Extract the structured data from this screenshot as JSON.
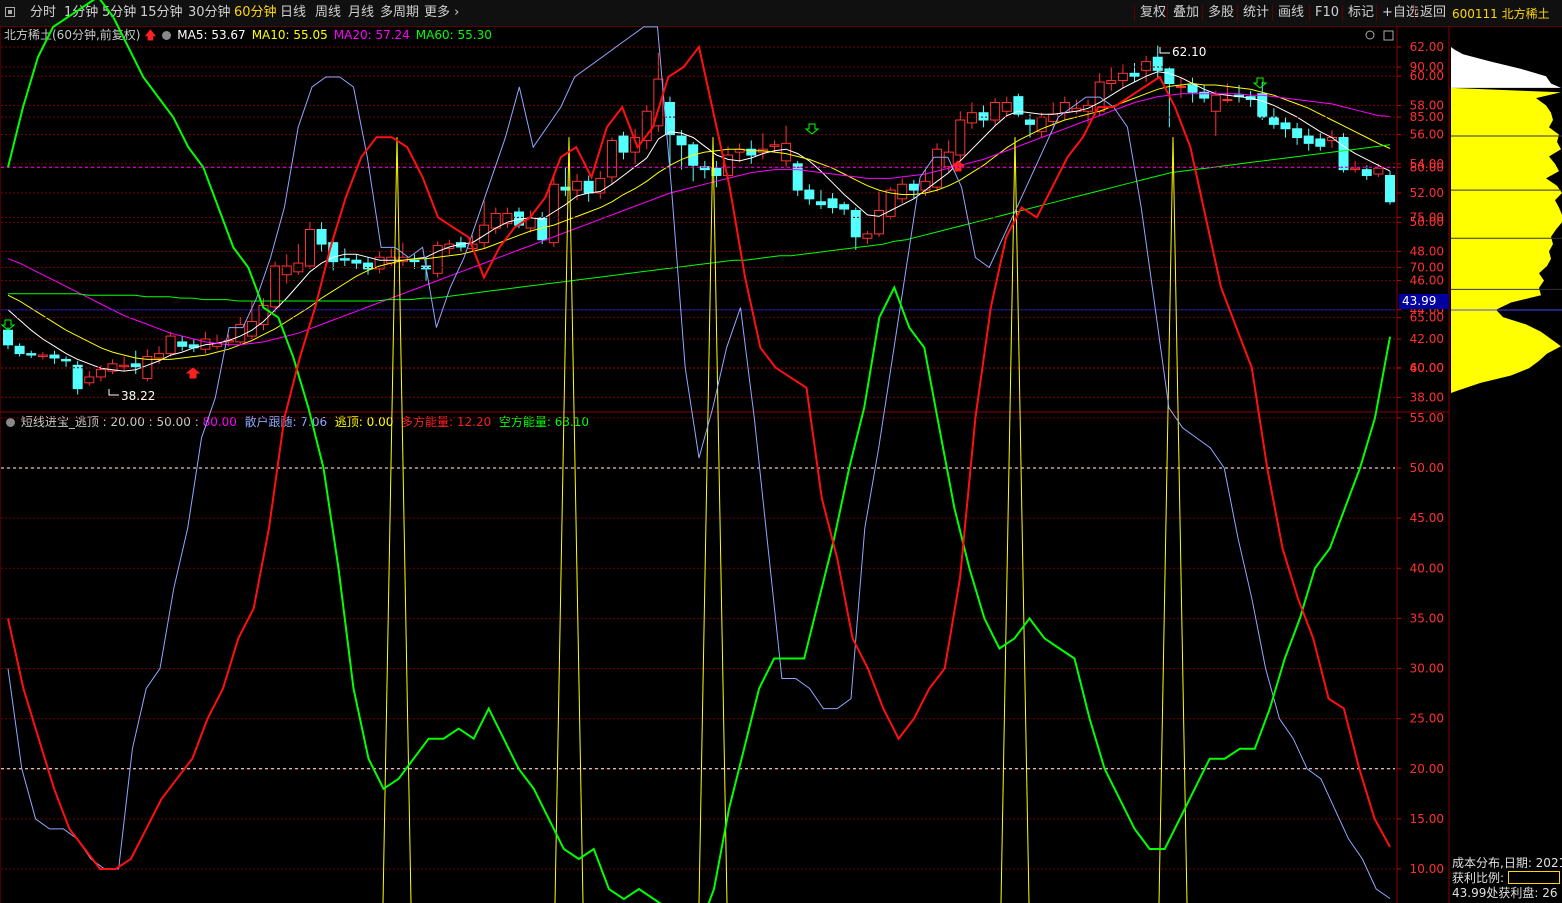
{
  "toolbar": {
    "periods": [
      "分时",
      "1分钟",
      "5分钟",
      "15分钟",
      "30分钟",
      "60分钟",
      "日线",
      "周线",
      "月线",
      "多周期",
      "更多 ›"
    ],
    "active_period": "60分钟",
    "right_buttons": [
      "复权",
      "叠加",
      "多股",
      "统计",
      "画线",
      "F10",
      "标记",
      "+自选",
      "返回"
    ]
  },
  "stock": {
    "code_name": "600111 北方稀土"
  },
  "main_chart": {
    "title": "北方稀土(60分钟,前复权)",
    "ma_labels": [
      {
        "text": "MA5: 53.67",
        "color": "#ffffff"
      },
      {
        "text": "MA10: 55.05",
        "color": "#ffff00"
      },
      {
        "text": "MA20: 57.24",
        "color": "#ff00ff"
      },
      {
        "text": "MA60: 55.30",
        "color": "#00ff00"
      }
    ],
    "price_axis": [
      "62.00",
      "60.00",
      "58.00",
      "56.00",
      "54.00",
      "52.00",
      "50.00",
      "48.00",
      "46.00",
      "44.00",
      "42.00",
      "40.00",
      "38.00"
    ],
    "current_price": "43.99",
    "high_label": "62.10",
    "low_label": "38.22"
  },
  "indicator": {
    "title_parts": [
      {
        "text": "短线进宝_逃顶 : 20.00 : 50.00 : ",
        "color": "#c8c8c8"
      },
      {
        "text": "80.00",
        "color": "#ff00ff"
      },
      {
        "text": "  散户跟随: 7.06",
        "color": "#8ea8ff"
      },
      {
        "text": "  逃顶: 0.00",
        "color": "#ffff00"
      },
      {
        "text": "  多方能量: ",
        "color": "#ff2020"
      },
      {
        "text": "12.20",
        "color": "#ff2020"
      },
      {
        "text": "  空方能量: 63.10",
        "color": "#00ff00"
      }
    ],
    "axis": [
      "90.00",
      "85.00",
      "80.00",
      "75.00",
      "70.00",
      "65.00",
      "60.00",
      "55.00",
      "50.00",
      "45.00",
      "40.00",
      "35.00",
      "30.00",
      "25.00",
      "20.00",
      "15.00",
      "10.00"
    ]
  },
  "side_panel": {
    "cost_dist": "成本分布,日期: 2021",
    "profit_ratio": "获利比例:",
    "profit_line": "43.99处获利盘: 26"
  },
  "colors": {
    "up": "#ff3232",
    "down": "#54ffff",
    "ma5": "#ffffff",
    "ma10": "#ffff00",
    "ma20": "#ff00ff",
    "ma60": "#00ff00"
  },
  "chart_data": {
    "type": "candlestick",
    "candles": [
      [
        42.6,
        41.6,
        42.8,
        41.3
      ],
      [
        41.5,
        41.0,
        41.7,
        40.8
      ],
      [
        41.0,
        40.9,
        41.2,
        40.7
      ],
      [
        40.8,
        40.9,
        41.1,
        40.6
      ],
      [
        40.9,
        40.7,
        41.2,
        40.3
      ],
      [
        40.6,
        40.5,
        40.8,
        40.1
      ],
      [
        40.2,
        38.6,
        40.5,
        38.2
      ],
      [
        39.0,
        39.4,
        39.8,
        38.8
      ],
      [
        39.4,
        39.9,
        40.2,
        39.1
      ],
      [
        39.8,
        40.3,
        40.6,
        39.6
      ],
      [
        40.1,
        40.2,
        40.8,
        39.8
      ],
      [
        40.3,
        40.1,
        41.2,
        39.6
      ],
      [
        39.3,
        40.8,
        41.3,
        39.1
      ],
      [
        40.7,
        41.0,
        41.5,
        40.3
      ],
      [
        41.0,
        42.2,
        42.5,
        40.8
      ],
      [
        41.8,
        41.5,
        42.2,
        41.2
      ],
      [
        41.6,
        41.4,
        42.0,
        41.1
      ],
      [
        41.3,
        42.0,
        42.5,
        41.0
      ],
      [
        41.5,
        41.7,
        42.3,
        41.3
      ],
      [
        41.8,
        41.9,
        42.3,
        41.5
      ],
      [
        41.8,
        43.0,
        43.5,
        41.6
      ],
      [
        42.2,
        43.2,
        44.6,
        42.0
      ],
      [
        43.0,
        44.3,
        44.8,
        42.6
      ],
      [
        44.2,
        47.0,
        47.3,
        43.8
      ],
      [
        46.4,
        47.0,
        47.8,
        45.8
      ],
      [
        46.6,
        47.2,
        48.5,
        46.4
      ],
      [
        47.0,
        49.5,
        50.0,
        46.8
      ],
      [
        49.5,
        48.5,
        50.0,
        48.0
      ],
      [
        48.6,
        47.3,
        48.7,
        46.7
      ],
      [
        47.5,
        47.4,
        48.2,
        47.0
      ],
      [
        47.4,
        47.2,
        47.8,
        46.8
      ],
      [
        47.2,
        46.8,
        47.6,
        46.4
      ],
      [
        46.8,
        47.6,
        48.0,
        46.5
      ],
      [
        47.2,
        47.6,
        48.2,
        47.0
      ],
      [
        47.3,
        47.6,
        48.6,
        47.0
      ],
      [
        47.4,
        47.3,
        47.8,
        46.8
      ],
      [
        47.0,
        46.8,
        47.6,
        46.0
      ],
      [
        46.5,
        48.4,
        48.7,
        46.2
      ],
      [
        48.2,
        48.5,
        48.8,
        47.8
      ],
      [
        48.6,
        48.3,
        49.0,
        48.0
      ],
      [
        48.2,
        48.5,
        49.1,
        48.0
      ],
      [
        48.6,
        49.8,
        51.5,
        48.2
      ],
      [
        49.6,
        50.6,
        51.0,
        49.2
      ],
      [
        49.9,
        50.6,
        51.0,
        49.6
      ],
      [
        50.7,
        49.8,
        51.0,
        49.6
      ],
      [
        49.6,
        50.3,
        50.8,
        49.3
      ],
      [
        50.3,
        48.8,
        50.7,
        48.5
      ],
      [
        48.6,
        52.6,
        53.2,
        48.3
      ],
      [
        52.4,
        52.2,
        53.8,
        51.8
      ],
      [
        52.2,
        52.8,
        53.3,
        51.5
      ],
      [
        52.8,
        52.0,
        53.2,
        51.4
      ],
      [
        52.0,
        53.0,
        53.5,
        51.6
      ],
      [
        53.1,
        55.6,
        55.8,
        52.6
      ],
      [
        55.9,
        54.8,
        56.2,
        54.3
      ],
      [
        54.8,
        55.8,
        56.4,
        54.0
      ],
      [
        55.6,
        57.6,
        58.0,
        55.0
      ],
      [
        56.6,
        59.8,
        61.6,
        56.2
      ],
      [
        58.2,
        56.0,
        58.6,
        53.4
      ],
      [
        55.9,
        55.3,
        56.3,
        53.6
      ],
      [
        55.3,
        53.9,
        55.5,
        52.8
      ],
      [
        53.8,
        53.6,
        54.2,
        53.0
      ],
      [
        53.7,
        53.2,
        54.2,
        52.4
      ],
      [
        53.2,
        54.6,
        55.2,
        52.8
      ],
      [
        54.8,
        55.0,
        55.4,
        54.1
      ],
      [
        55.0,
        54.6,
        55.6,
        54.0
      ],
      [
        54.8,
        55.0,
        56.1,
        54.3
      ],
      [
        55.2,
        55.3,
        55.6,
        54.8
      ],
      [
        54.2,
        55.4,
        56.6,
        53.8
      ],
      [
        54.0,
        52.2,
        54.2,
        51.8
      ],
      [
        52.2,
        51.6,
        52.6,
        51.2
      ],
      [
        51.4,
        51.2,
        52.2,
        50.9
      ],
      [
        51.6,
        51.0,
        52.0,
        50.6
      ],
      [
        51.2,
        50.9,
        51.4,
        50.5
      ],
      [
        50.8,
        49.0,
        51.0,
        48.1
      ],
      [
        48.9,
        49.2,
        49.4,
        48.5
      ],
      [
        49.2,
        50.8,
        52.1,
        49.0
      ],
      [
        50.4,
        52.2,
        52.4,
        50.2
      ],
      [
        51.6,
        52.6,
        53.0,
        51.3
      ],
      [
        52.6,
        52.2,
        52.9,
        51.6
      ],
      [
        52.2,
        52.8,
        53.6,
        51.8
      ],
      [
        52.4,
        55.0,
        55.4,
        52.1
      ],
      [
        53.8,
        54.8,
        55.6,
        53.4
      ],
      [
        54.6,
        57.0,
        57.6,
        54.2
      ],
      [
        56.8,
        57.5,
        58.2,
        56.4
      ],
      [
        57.5,
        57.0,
        58.0,
        56.5
      ],
      [
        57.0,
        58.2,
        58.5,
        56.6
      ],
      [
        57.6,
        58.2,
        58.6,
        57.2
      ],
      [
        58.6,
        57.4,
        58.8,
        57.2
      ],
      [
        57.0,
        56.7,
        57.4,
        55.8
      ],
      [
        56.2,
        57.2,
        57.5,
        55.8
      ],
      [
        56.9,
        57.4,
        58.2,
        56.4
      ],
      [
        57.5,
        58.2,
        58.6,
        57.0
      ],
      [
        57.6,
        57.8,
        58.4,
        57.4
      ],
      [
        57.6,
        58.0,
        58.4,
        56.8
      ],
      [
        57.6,
        59.6,
        60.2,
        57.3
      ],
      [
        59.5,
        59.7,
        60.6,
        59.0
      ],
      [
        59.7,
        60.2,
        60.8,
        59.2
      ],
      [
        60.2,
        60.0,
        60.9,
        59.6
      ],
      [
        60.4,
        61.0,
        61.4,
        59.6
      ],
      [
        61.3,
        60.4,
        62.1,
        59.8
      ],
      [
        60.5,
        59.5,
        60.6,
        56.5
      ],
      [
        59.3,
        59.3,
        59.9,
        58.5
      ],
      [
        59.4,
        58.9,
        59.9,
        58.2
      ],
      [
        58.9,
        58.5,
        59.4,
        58.2
      ],
      [
        57.6,
        58.7,
        59.0,
        55.9
      ],
      [
        58.4,
        58.4,
        59.5,
        58.2
      ],
      [
        58.7,
        58.6,
        59.4,
        58.2
      ],
      [
        58.6,
        58.4,
        59.0,
        57.9
      ],
      [
        58.8,
        57.2,
        59.6,
        57.0
      ],
      [
        57.2,
        56.7,
        57.8,
        56.4
      ],
      [
        56.8,
        56.4,
        57.2,
        55.8
      ],
      [
        56.4,
        55.8,
        56.8,
        55.3
      ],
      [
        55.9,
        55.4,
        56.4,
        54.9
      ],
      [
        55.7,
        55.2,
        56.1,
        54.9
      ],
      [
        55.6,
        55.8,
        56.3,
        55.1
      ],
      [
        55.8,
        53.6,
        56.1,
        53.4
      ],
      [
        53.6,
        53.7,
        54.2,
        53.4
      ],
      [
        53.6,
        53.2,
        53.9,
        52.9
      ],
      [
        53.3,
        53.7,
        54.0,
        53.1
      ],
      [
        53.2,
        51.4,
        53.5,
        51.2
      ]
    ],
    "ma5": [
      44.0,
      43.3,
      42.6,
      42.0,
      41.5,
      41.0,
      40.6,
      40.3,
      40.0,
      39.9,
      39.8,
      39.9,
      40.2,
      40.5,
      40.9,
      41.1,
      41.4,
      41.6,
      41.7,
      41.9,
      42.2,
      42.6,
      43.2,
      44.0,
      44.8,
      45.7,
      46.6,
      47.2,
      47.6,
      47.8,
      47.8,
      47.6,
      47.4,
      47.4,
      47.4,
      47.5,
      47.6,
      48.0,
      48.3,
      48.5,
      48.6,
      49.1,
      49.6,
      50.0,
      50.2,
      50.3,
      50.2,
      50.7,
      51.2,
      51.8,
      52.0,
      52.1,
      52.6,
      53.2,
      53.8,
      54.4,
      55.7,
      56.2,
      56.1,
      55.8,
      55.2,
      54.6,
      54.3,
      54.2,
      54.4,
      54.7,
      54.9,
      55.0,
      54.7,
      54.2,
      53.5,
      52.7,
      51.9,
      51.2,
      50.5,
      50.4,
      50.8,
      51.2,
      51.6,
      52.2,
      52.8,
      53.4,
      54.2,
      55.0,
      55.8,
      56.6,
      57.3,
      57.6,
      57.5,
      57.4,
      57.4,
      57.5,
      57.6,
      57.8,
      58.2,
      58.7,
      59.2,
      59.6,
      60.0,
      60.3,
      60.2,
      59.9,
      59.5,
      59.1,
      58.8,
      58.7,
      58.6,
      58.5,
      58.3,
      58.0,
      57.6,
      57.2,
      56.7,
      56.2,
      55.8,
      55.2,
      54.7,
      54.3,
      53.9,
      53.5
    ],
    "ma10": [
      45.0,
      44.6,
      44.1,
      43.6,
      43.1,
      42.6,
      42.2,
      41.8,
      41.4,
      41.1,
      40.9,
      40.7,
      40.6,
      40.6,
      40.6,
      40.7,
      40.8,
      40.9,
      41.1,
      41.3,
      41.6,
      41.9,
      42.3,
      42.7,
      43.2,
      43.7,
      44.2,
      44.8,
      45.3,
      45.8,
      46.3,
      46.7,
      47.0,
      47.2,
      47.4,
      47.5,
      47.5,
      47.6,
      47.7,
      47.8,
      48.0,
      48.2,
      48.5,
      48.8,
      49.1,
      49.4,
      49.6,
      49.8,
      50.1,
      50.4,
      50.7,
      51.0,
      51.4,
      51.9,
      52.3,
      52.8,
      53.4,
      53.9,
      54.3,
      54.6,
      54.8,
      54.9,
      55.0,
      55.0,
      54.9,
      54.9,
      54.8,
      54.7,
      54.5,
      54.3,
      54.0,
      53.7,
      53.3,
      52.9,
      52.5,
      52.2,
      52.0,
      51.9,
      51.9,
      52.0,
      52.2,
      52.5,
      52.9,
      53.4,
      53.9,
      54.5,
      55.1,
      55.6,
      56.0,
      56.4,
      56.7,
      57.0,
      57.2,
      57.4,
      57.6,
      57.9,
      58.2,
      58.5,
      58.8,
      59.1,
      59.3,
      59.4,
      59.5,
      59.4,
      59.4,
      59.3,
      59.2,
      59.1,
      58.9,
      58.7,
      58.4,
      58.1,
      57.8,
      57.4,
      57.0,
      56.6,
      56.2,
      55.8,
      55.4,
      55.05
    ],
    "ma20": [
      47.5,
      47.2,
      46.8,
      46.4,
      46.0,
      45.6,
      45.2,
      44.8,
      44.4,
      44.0,
      43.6,
      43.3,
      43.0,
      42.7,
      42.4,
      42.2,
      42.0,
      41.8,
      41.7,
      41.6,
      41.6,
      41.7,
      41.8,
      42.0,
      42.2,
      42.4,
      42.7,
      43.0,
      43.3,
      43.6,
      43.9,
      44.2,
      44.5,
      44.8,
      45.1,
      45.4,
      45.7,
      46.0,
      46.3,
      46.6,
      46.9,
      47.2,
      47.5,
      47.8,
      48.1,
      48.4,
      48.7,
      49.0,
      49.3,
      49.6,
      49.9,
      50.2,
      50.5,
      50.8,
      51.1,
      51.4,
      51.7,
      52.0,
      52.2,
      52.4,
      52.6,
      52.8,
      53.0,
      53.2,
      53.4,
      53.5,
      53.6,
      53.6,
      53.6,
      53.5,
      53.4,
      53.3,
      53.2,
      53.1,
      53.0,
      53.0,
      53.0,
      53.1,
      53.2,
      53.3,
      53.5,
      53.7,
      53.9,
      54.1,
      54.3,
      54.6,
      54.9,
      55.2,
      55.5,
      55.8,
      56.1,
      56.4,
      56.7,
      57.0,
      57.3,
      57.6,
      57.9,
      58.2,
      58.4,
      58.6,
      58.7,
      58.8,
      58.8,
      58.8,
      58.8,
      58.8,
      58.8,
      58.7,
      58.7,
      58.6,
      58.5,
      58.4,
      58.3,
      58.2,
      58.1,
      57.9,
      57.7,
      57.5,
      57.3,
      57.24
    ],
    "ma60": [
      45.1,
      45.1,
      45.1,
      45.1,
      45.1,
      45.1,
      45.1,
      45.0,
      45.0,
      45.0,
      45.0,
      45.0,
      44.9,
      44.9,
      44.9,
      44.8,
      44.8,
      44.7,
      44.7,
      44.7,
      44.6,
      44.6,
      44.6,
      44.6,
      44.6,
      44.6,
      44.6,
      44.6,
      44.6,
      44.6,
      44.6,
      44.6,
      44.6,
      44.7,
      44.7,
      44.7,
      44.8,
      44.8,
      44.9,
      45.0,
      45.1,
      45.2,
      45.3,
      45.4,
      45.5,
      45.6,
      45.7,
      45.8,
      45.9,
      46.0,
      46.1,
      46.2,
      46.3,
      46.4,
      46.5,
      46.6,
      46.7,
      46.8,
      46.9,
      47.0,
      47.1,
      47.2,
      47.3,
      47.4,
      47.4,
      47.5,
      47.6,
      47.7,
      47.7,
      47.8,
      47.9,
      48.0,
      48.1,
      48.2,
      48.3,
      48.4,
      48.5,
      48.7,
      48.8,
      49.0,
      49.2,
      49.4,
      49.6,
      49.8,
      50.0,
      50.2,
      50.4,
      50.6,
      50.8,
      51.0,
      51.2,
      51.4,
      51.6,
      51.8,
      52.0,
      52.2,
      52.4,
      52.6,
      52.8,
      53.0,
      53.2,
      53.4,
      53.5,
      53.6,
      53.7,
      53.8,
      53.9,
      54.0,
      54.1,
      54.2,
      54.3,
      54.4,
      54.5,
      54.6,
      54.7,
      54.8,
      54.9,
      55.0,
      55.1,
      55.2,
      55.3
    ],
    "ind_blue": [
      30,
      20,
      15,
      14,
      14,
      13,
      11,
      10,
      10,
      22,
      28,
      30,
      38,
      44,
      53,
      57,
      64,
      64,
      67,
      71,
      76,
      84,
      88,
      89,
      89,
      88,
      81,
      72,
      72,
      71,
      72,
      64,
      68,
      71,
      75,
      79,
      83,
      88,
      82,
      84,
      86,
      89,
      90,
      91,
      92,
      93,
      94,
      94,
      78,
      60,
      51,
      56,
      62,
      66,
      55,
      42,
      29,
      29,
      28,
      26,
      26,
      27,
      44,
      52,
      61,
      70,
      79,
      81,
      81,
      78,
      71,
      70,
      73,
      76,
      79,
      82,
      85,
      86,
      87,
      87,
      86,
      84,
      76,
      66,
      56,
      54,
      53,
      52,
      50,
      43,
      37,
      30,
      25,
      23,
      20,
      19,
      16,
      13,
      11,
      8,
      7.06
    ],
    "ind_red": [
      35,
      28,
      23,
      18,
      14,
      12,
      10,
      10,
      11,
      14,
      17,
      19,
      21,
      25,
      28,
      33,
      36,
      44,
      55,
      61,
      66,
      72,
      77,
      81,
      83,
      83,
      82,
      79,
      75,
      74,
      73,
      69,
      72,
      74,
      75,
      77,
      81,
      82,
      79,
      84,
      86,
      82,
      84,
      89,
      90,
      92,
      85,
      78,
      69,
      62,
      60,
      59,
      58,
      47,
      41,
      33,
      30,
      26,
      23,
      25,
      28,
      30,
      39,
      55,
      66,
      73,
      76,
      75,
      78,
      81,
      83,
      86,
      86,
      87,
      88,
      89,
      86,
      82,
      75,
      68,
      64,
      60,
      50,
      42,
      37,
      33,
      27,
      26,
      20,
      15,
      12.2
    ],
    "ind_green": [
      80,
      86,
      91,
      94,
      95,
      96,
      97,
      95,
      92,
      89,
      87,
      85,
      82,
      80,
      76,
      72,
      70,
      66,
      65,
      61,
      56,
      50,
      40,
      28,
      21,
      18,
      19,
      21,
      23,
      23,
      24,
      23,
      26,
      23,
      20,
      18,
      15,
      12,
      11,
      12,
      8,
      7,
      8,
      7,
      6,
      5,
      4,
      8,
      16,
      22,
      28,
      31,
      31,
      31,
      37,
      43,
      50,
      56,
      65,
      68,
      64,
      62,
      54,
      46,
      40,
      35,
      32,
      33,
      35,
      33,
      32,
      31,
      25,
      20,
      17,
      14,
      12,
      12,
      15,
      18,
      21,
      21,
      22,
      22,
      26,
      31,
      35,
      40,
      42,
      46,
      50,
      55,
      63.1
    ],
    "ind_spikes_x": [
      397,
      569,
      713,
      1015,
      1173
    ]
  }
}
